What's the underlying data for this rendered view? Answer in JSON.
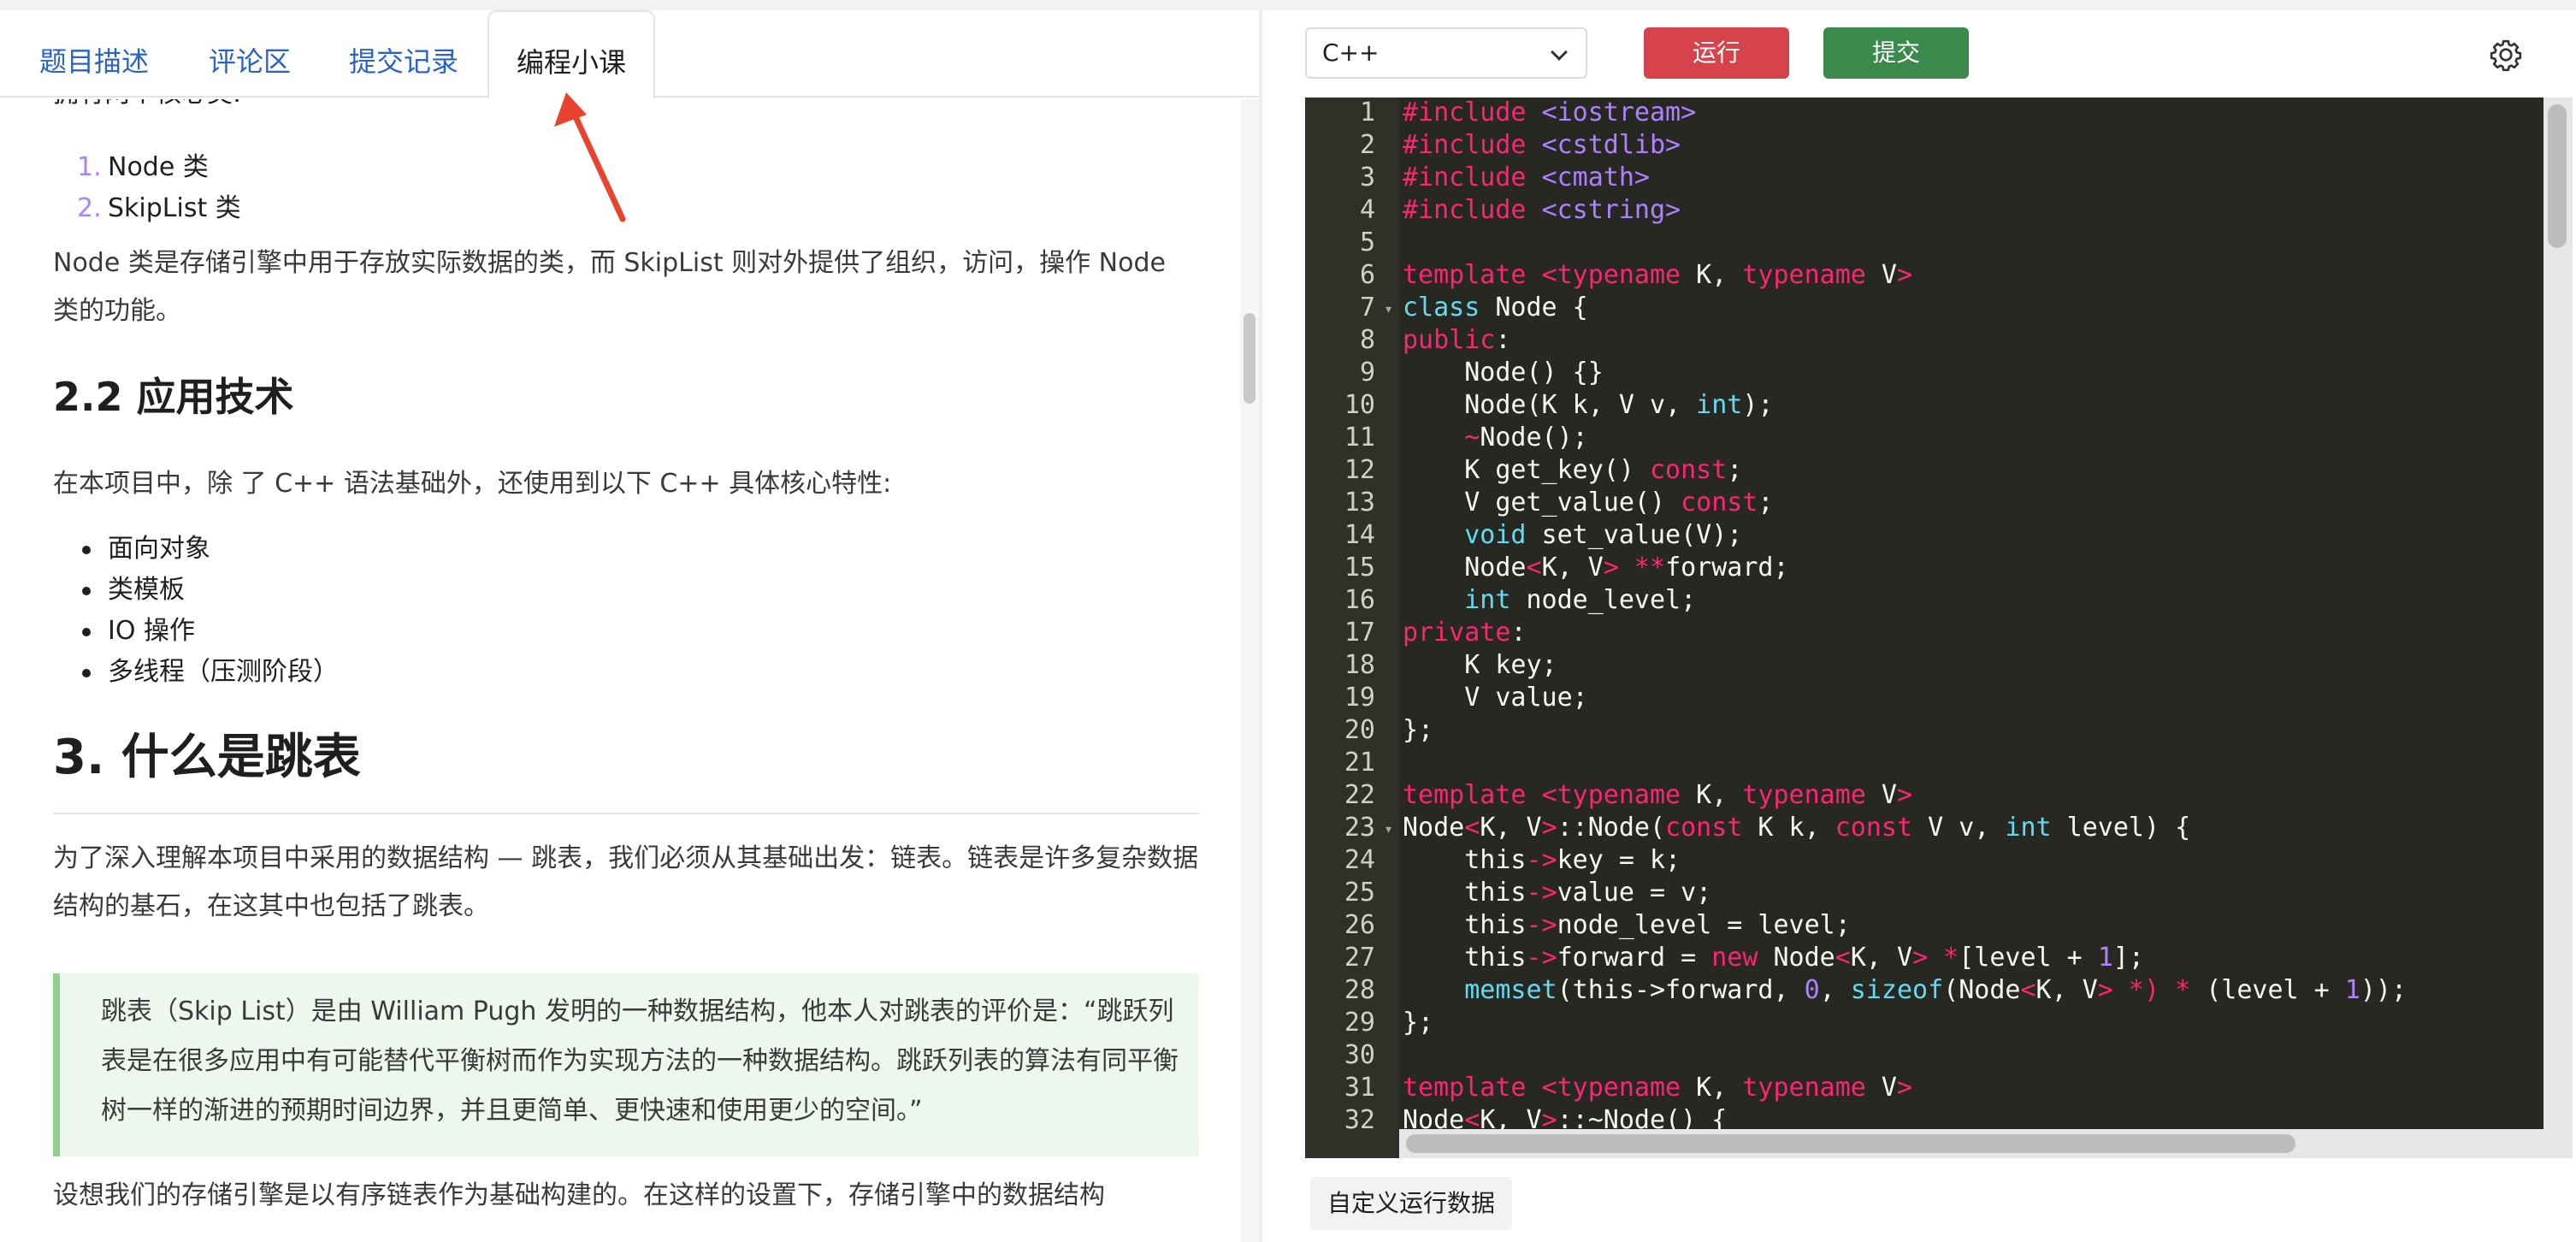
{
  "tabs": {
    "description": "题目描述",
    "comments": "评论区",
    "submissions": "提交记录",
    "lesson": "编程小课"
  },
  "content": {
    "partial_top": "拥有两个核心类:",
    "classes": [
      "Node 类",
      "SkipList 类"
    ],
    "class_nums": [
      "1.",
      "2."
    ],
    "node_intro": "Node 类是存储引擎中用于存放实际数据的类，而 SkipList 则对外提供了组织，访问，操作 Node 类的功能。",
    "h_tech": "2.2 应用技术",
    "tech_intro": "在本项目中，除 了 C++ 语法基础外，还使用到以下 C++ 具体核心特性:",
    "features": [
      "面向对象",
      "类模板",
      "IO 操作",
      "多线程（压测阶段）"
    ],
    "h_skip": "3. 什么是跳表",
    "skip_intro": "为了深入理解本项目中采用的数据结构 — 跳表，我们必须从其基础出发：链表。链表是许多复杂数据结构的基石，在这其中也包括了跳表。",
    "quote": "跳表（Skip List）是由 William Pugh 发明的一种数据结构，他本人对跳表的评价是：“跳跃列表是在很多应用中有可能替代平衡树而作为实现方法的一种数据结构。跳跃列表的算法有同平衡树一样的渐进的预期时间边界，并且更简单、更快速和使用更少的空间。”",
    "bottom": "设想我们的存储引擎是以有序链表作为基础构建的。在这样的设置下，存储引擎中的数据结构"
  },
  "editor": {
    "language": "C++",
    "run_label": "运行",
    "submit_label": "提交",
    "custom_run_label": "自定义运行数据",
    "line_numbers": [
      "1",
      "2",
      "3",
      "4",
      "5",
      "6",
      "7",
      "8",
      "9",
      "10",
      "11",
      "12",
      "13",
      "14",
      "15",
      "16",
      "17",
      "18",
      "19",
      "20",
      "21",
      "22",
      "23",
      "24",
      "25",
      "26",
      "27",
      "28",
      "29",
      "30",
      "31",
      "32"
    ],
    "tokens": {
      "include": "#include",
      "iostream": "<iostream>",
      "cstdlib": "<cstdlib>",
      "cmath": "<cmath>",
      "cstring": "<cstring>",
      "template": "template",
      "lt": "<",
      "gt": ">",
      "typename": "typename",
      "k_comma": " K, ",
      "v_only": " V",
      "class": "class",
      "node_brace": " Node {",
      "public": "public",
      "private": "private",
      "colon": ":",
      "ctor_default": "    Node() {}",
      "ctor_decl_a": "    Node(K k, V v, ",
      "int": "int",
      "close_semi": ");",
      "indent": "    ",
      "tilde": "~",
      "dtor_rest": "Node();",
      "getkey_a": "    K get_key() ",
      "const": "const",
      "semi": ";",
      "getvalue_a": "    V get_value() ",
      "void": "void",
      "setvalue_rest": " set_value(V);",
      "node": "Node",
      "kv_sep": "K, V",
      "stars": " **",
      "forward_semi": "forward;",
      "nodelevel_rest": " node_level;",
      "key_decl": "    K key;",
      "value_decl": "    V value;",
      "close_class": "};",
      "node_scope_a": "Node",
      "node_scope_b": "::Node(",
      "k_k": " K k, ",
      "v_v": " V v, ",
      "level_open": " level) {",
      "this": "this",
      "arrow": "->",
      "key_assign": "key = k;",
      "value_assign": "value = v;",
      "nodelevel_assign": "node_level = level;",
      "forward_eq": "forward = ",
      "new": "new",
      "star_bracket": " *",
      "level_plus": "[level + ",
      "one": "1",
      "bracket_semi": "];",
      "memset": "memset",
      "memset_args": "(this->forward, ",
      "zero": "0",
      "comma_sp": ", ",
      "sizeof": "sizeof",
      "node_paren": "(Node",
      "star_close": " *) ",
      "star_op": "*",
      "level_open2": " (level + ",
      "double_close": "));",
      "dtor_scope": "::~Node() {"
    }
  }
}
